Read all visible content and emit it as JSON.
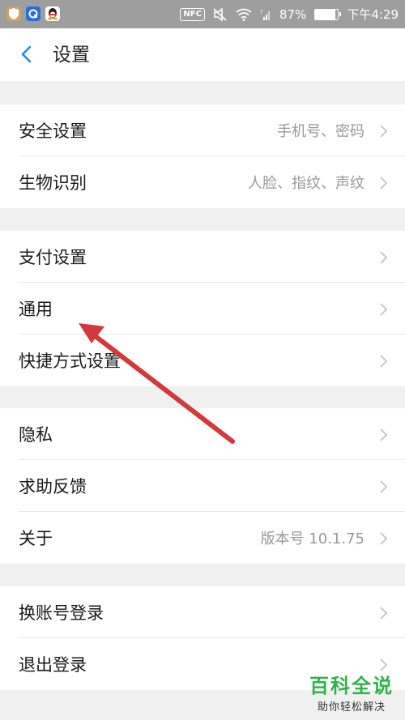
{
  "status_bar": {
    "nfc_label": "NFC",
    "battery_text": "87%",
    "battery_level": 0.87,
    "time": "下午4:29",
    "icons": [
      "shield-app-icon",
      "browser-app-icon",
      "qq-app-icon",
      "mute-icon",
      "wifi-icon",
      "signal-icon"
    ]
  },
  "header": {
    "title": "设置",
    "back_icon": "chevron-left-icon"
  },
  "groups": [
    [
      {
        "label": "安全设置",
        "value": "手机号、密码"
      },
      {
        "label": "生物识别",
        "value": "人脸、指纹、声纹"
      }
    ],
    [
      {
        "label": "支付设置",
        "value": ""
      },
      {
        "label": "通用",
        "value": ""
      },
      {
        "label": "快捷方式设置",
        "value": ""
      }
    ],
    [
      {
        "label": "隐私",
        "value": ""
      },
      {
        "label": "求助反馈",
        "value": ""
      },
      {
        "label": "关于",
        "value": "版本号 10.1.75"
      }
    ],
    [
      {
        "label": "换账号登录",
        "value": ""
      },
      {
        "label": "退出登录",
        "value": ""
      }
    ]
  ],
  "watermark": {
    "title": "百科全说",
    "subtitle": "助你轻松解决"
  },
  "colors": {
    "accent": "#1a8fe3",
    "annotation_arrow": "#d2383c",
    "watermark_green": "#2fb34a"
  }
}
